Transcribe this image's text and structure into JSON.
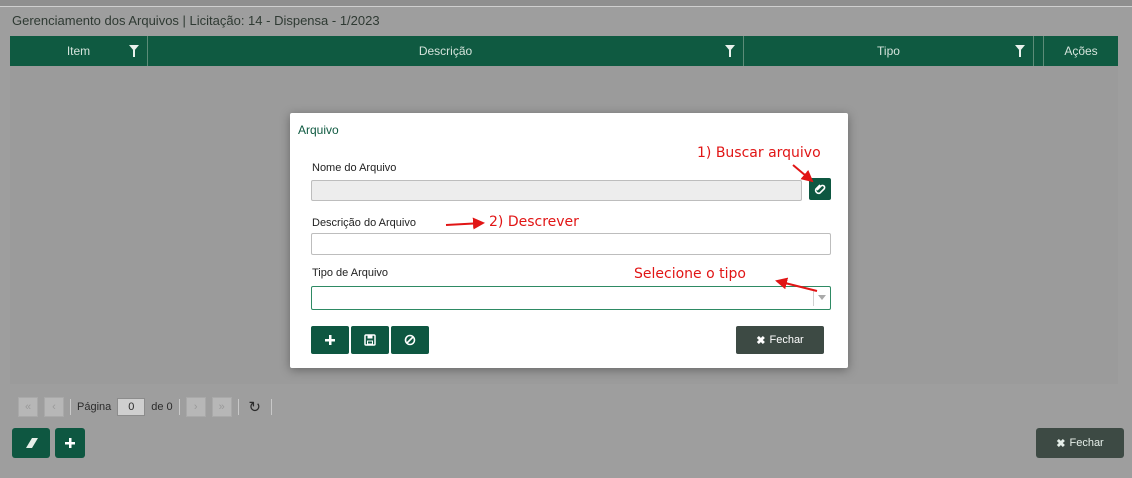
{
  "window": {
    "title": "Gerenciamento dos Arquivos | Licitação: 14 - Dispensa - 1/2023"
  },
  "grid": {
    "columns": [
      {
        "label": "Item"
      },
      {
        "label": "Descrição"
      },
      {
        "label": "Tipo"
      },
      {
        "label": "Ações"
      }
    ],
    "pager": {
      "page_label": "Página",
      "page_value": "0",
      "of_label": "de 0"
    }
  },
  "bottom_bar": {
    "close_label": "Fechar"
  },
  "dialog": {
    "title": "Arquivo",
    "file_name_label": "Nome do Arquivo",
    "file_name_value": "",
    "description_label": "Descrição do Arquivo",
    "description_value": "",
    "type_label": "Tipo de Arquivo",
    "type_value": "",
    "close_label": "Fechar"
  },
  "annotations": {
    "step1": "1) Buscar arquivo",
    "step2": "2) Descrever",
    "step3": "Selecione o tipo"
  },
  "colors": {
    "header_green": "#0f5a41",
    "button_green": "#0e5741",
    "button_dark": "#3d4a44",
    "annotation_red": "#e11515"
  }
}
